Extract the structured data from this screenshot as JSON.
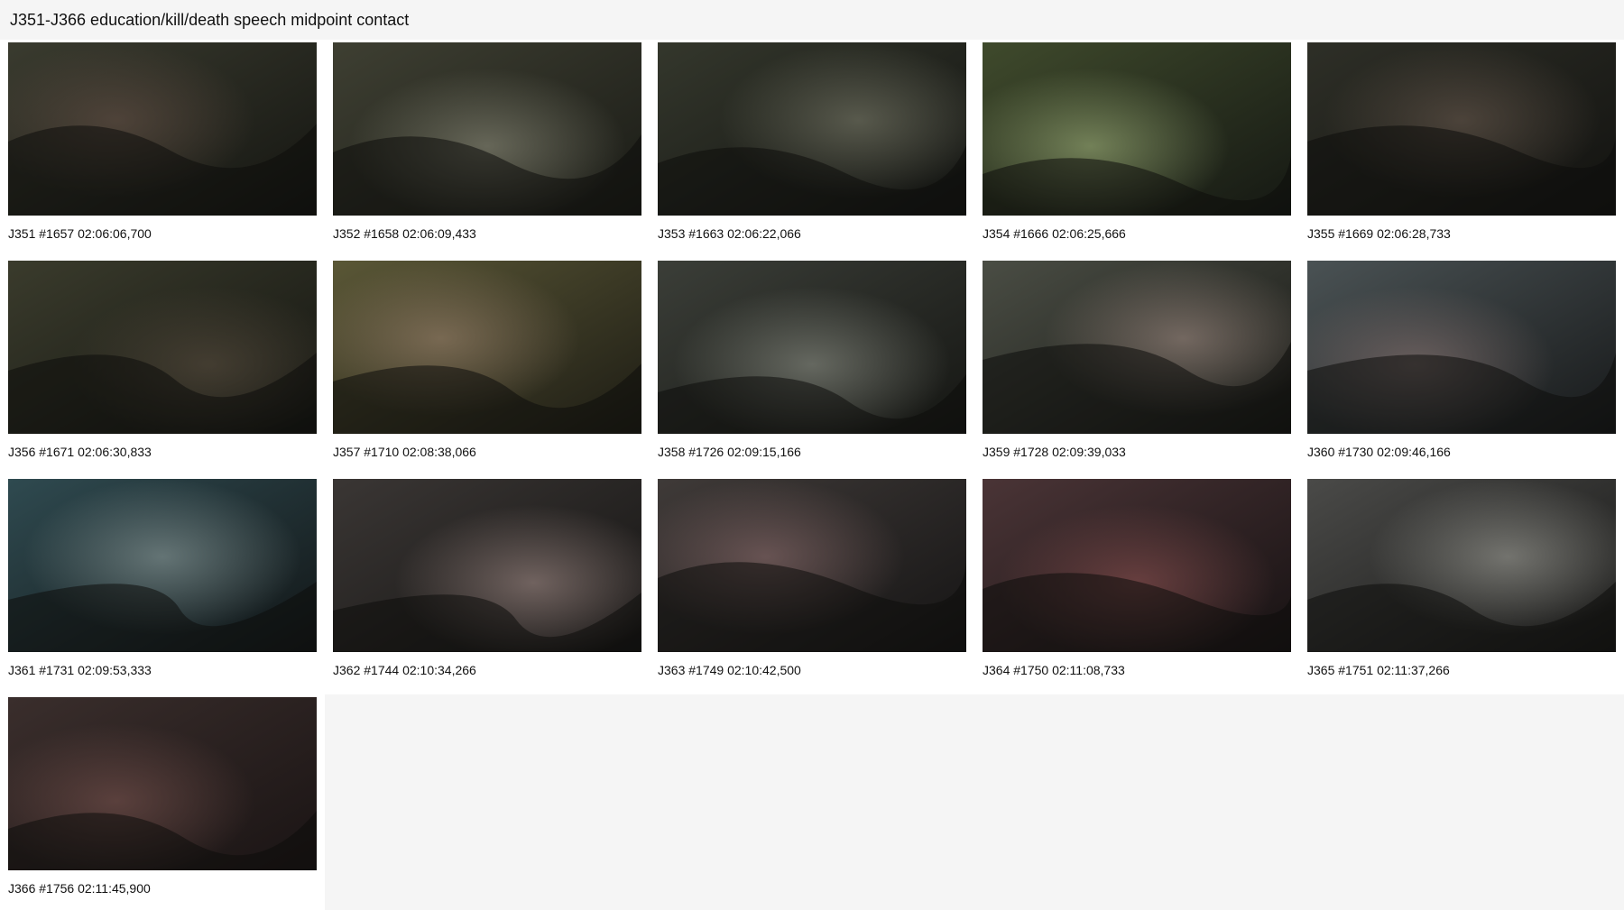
{
  "title": "J351-J366 education/kill/death speech midpoint contact",
  "frames": [
    {
      "caption": "J351 #1657 02:06:06,700",
      "tone": [
        "#3a3b2f",
        "#141511",
        "#5a4a40"
      ]
    },
    {
      "caption": "J352 #1658 02:06:09,433",
      "tone": [
        "#3e3f32",
        "#1a1b16",
        "#7a7a6a"
      ]
    },
    {
      "caption": "J353 #1663 02:06:22,066",
      "tone": [
        "#34372c",
        "#121311",
        "#6a6b5c"
      ]
    },
    {
      "caption": "J354 #1666 02:06:25,666",
      "tone": [
        "#3f4a2c",
        "#151813",
        "#8a9a6a"
      ]
    },
    {
      "caption": "J355 #1669 02:06:28,733",
      "tone": [
        "#2e2f27",
        "#121210",
        "#5a4e44"
      ]
    },
    {
      "caption": "J356 #1671 02:06:30,833",
      "tone": [
        "#3a3b2c",
        "#141511",
        "#4e4538"
      ]
    },
    {
      "caption": "J357 #1710 02:08:38,066",
      "tone": [
        "#5a5736",
        "#1d1c14",
        "#8a7660"
      ]
    },
    {
      "caption": "J358 #1726 02:09:15,166",
      "tone": [
        "#3b3e38",
        "#151613",
        "#7a7d74"
      ]
    },
    {
      "caption": "J359 #1728 02:09:39,033",
      "tone": [
        "#4a4d44",
        "#161714",
        "#8a7a72"
      ]
    },
    {
      "caption": "J360 #1730 02:09:46,166",
      "tone": [
        "#4a5254",
        "#17191a",
        "#7a6a68"
      ]
    },
    {
      "caption": "J361 #1731 02:09:53,333",
      "tone": [
        "#2f4a50",
        "#121617",
        "#7a8a8a"
      ]
    },
    {
      "caption": "J362 #1744 02:10:34,266",
      "tone": [
        "#3a3634",
        "#151413",
        "#8a7874"
      ]
    },
    {
      "caption": "J363 #1749 02:10:42,500",
      "tone": [
        "#3f3a38",
        "#151414",
        "#7a6060"
      ]
    },
    {
      "caption": "J364 #1750 02:11:08,733",
      "tone": [
        "#4a3436",
        "#171213",
        "#7a4848"
      ]
    },
    {
      "caption": "J365 #1751 02:11:37,266",
      "tone": [
        "#4a4a48",
        "#171716",
        "#8a8a84"
      ]
    },
    {
      "caption": "J366 #1756 02:11:45,900",
      "tone": [
        "#3a2e2c",
        "#1a1414",
        "#6a4a46"
      ]
    }
  ]
}
